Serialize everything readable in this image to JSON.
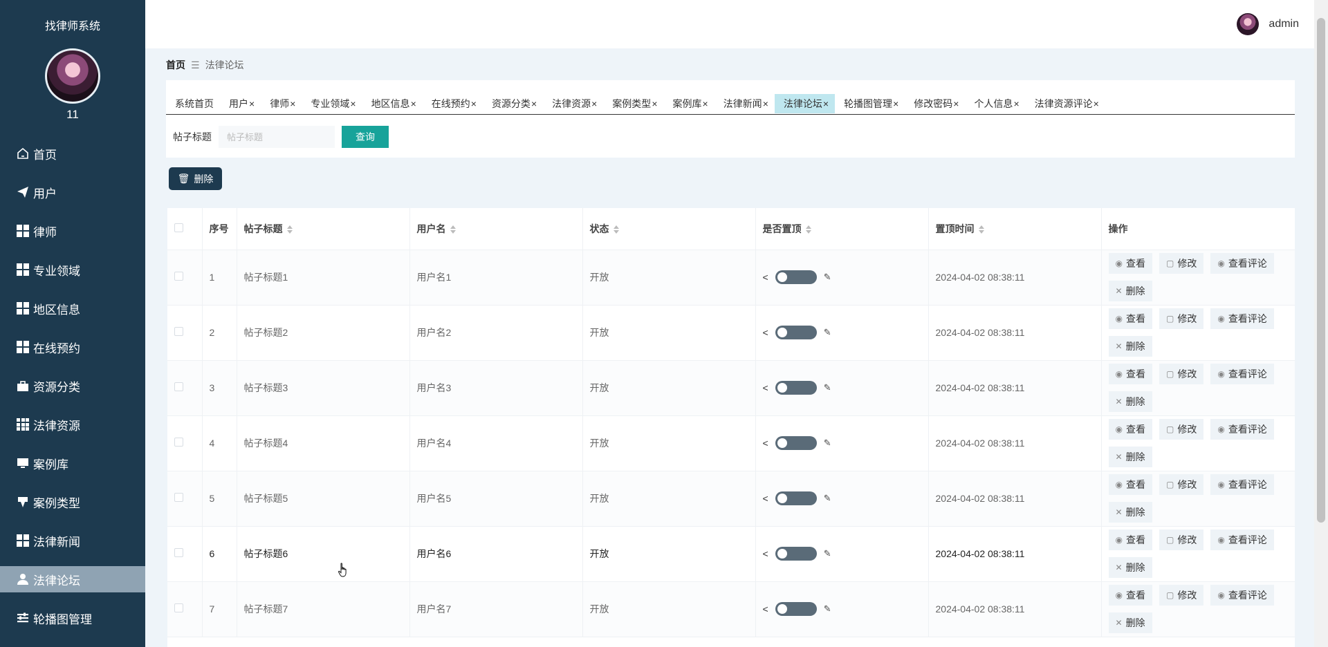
{
  "sidebar": {
    "system_title": "找律师系统",
    "user_number": "11",
    "items": [
      {
        "label": "首页",
        "icon": "home-icon"
      },
      {
        "label": "用户",
        "icon": "paper-plane-icon"
      },
      {
        "label": "律师",
        "icon": "grid-icon"
      },
      {
        "label": "专业领域",
        "icon": "grid-icon"
      },
      {
        "label": "地区信息",
        "icon": "grid-icon"
      },
      {
        "label": "在线预约",
        "icon": "grid-icon"
      },
      {
        "label": "资源分类",
        "icon": "briefcase-icon"
      },
      {
        "label": "法律资源",
        "icon": "grid9-icon"
      },
      {
        "label": "案例库",
        "icon": "monitor-icon"
      },
      {
        "label": "案例类型",
        "icon": "pin-icon"
      },
      {
        "label": "法律新闻",
        "icon": "grid-icon"
      },
      {
        "label": "法律论坛",
        "icon": "user-icon",
        "active": true
      },
      {
        "label": "轮播图管理",
        "icon": "sliders-icon"
      }
    ]
  },
  "header": {
    "username": "admin"
  },
  "breadcrumb": {
    "home": "首页",
    "separator": "☰",
    "current": "法律论坛"
  },
  "tabs": [
    {
      "label": "系统首页",
      "closable": false
    },
    {
      "label": "用户",
      "closable": true
    },
    {
      "label": "律师",
      "closable": true
    },
    {
      "label": "专业领域",
      "closable": true
    },
    {
      "label": "地区信息",
      "closable": true
    },
    {
      "label": "在线预约",
      "closable": true
    },
    {
      "label": "资源分类",
      "closable": true
    },
    {
      "label": "法律资源",
      "closable": true
    },
    {
      "label": "案例类型",
      "closable": true
    },
    {
      "label": "案例库",
      "closable": true
    },
    {
      "label": "法律新闻",
      "closable": true
    },
    {
      "label": "法律论坛",
      "closable": true,
      "active": true
    },
    {
      "label": "轮播图管理",
      "closable": true
    },
    {
      "label": "修改密码",
      "closable": true
    },
    {
      "label": "个人信息",
      "closable": true
    },
    {
      "label": "法律资源评论",
      "closable": true
    }
  ],
  "search": {
    "label": "帖子标题",
    "placeholder": "帖子标题",
    "button": "查询"
  },
  "toolbar": {
    "delete_label": "删除"
  },
  "table": {
    "headers": [
      "序号",
      "帖子标题",
      "用户名",
      "状态",
      "是否置顶",
      "置顶时间",
      "操作"
    ],
    "actions": {
      "view": "查看",
      "edit": "修改",
      "comments": "查看评论",
      "delete": "删除"
    },
    "rows": [
      {
        "no": "1",
        "title": "帖子标题1",
        "username": "用户名1",
        "status": "开放",
        "time": "2024-04-02 08:38:11"
      },
      {
        "no": "2",
        "title": "帖子标题2",
        "username": "用户名2",
        "status": "开放",
        "time": "2024-04-02 08:38:11"
      },
      {
        "no": "3",
        "title": "帖子标题3",
        "username": "用户名3",
        "status": "开放",
        "time": "2024-04-02 08:38:11"
      },
      {
        "no": "4",
        "title": "帖子标题4",
        "username": "用户名4",
        "status": "开放",
        "time": "2024-04-02 08:38:11"
      },
      {
        "no": "5",
        "title": "帖子标题5",
        "username": "用户名5",
        "status": "开放",
        "time": "2024-04-02 08:38:11"
      },
      {
        "no": "6",
        "title": "帖子标题6",
        "username": "用户名6",
        "status": "开放",
        "time": "2024-04-02 08:38:11",
        "hover": true
      },
      {
        "no": "7",
        "title": "帖子标题7",
        "username": "用户名7",
        "status": "开放",
        "time": "2024-04-02 08:38:11"
      }
    ]
  },
  "colors": {
    "sidebar_bg": "#1d3a4f",
    "accent": "#17a39a",
    "active_tab": "#bfe7ef",
    "active_menu": "#8fa3b3"
  }
}
